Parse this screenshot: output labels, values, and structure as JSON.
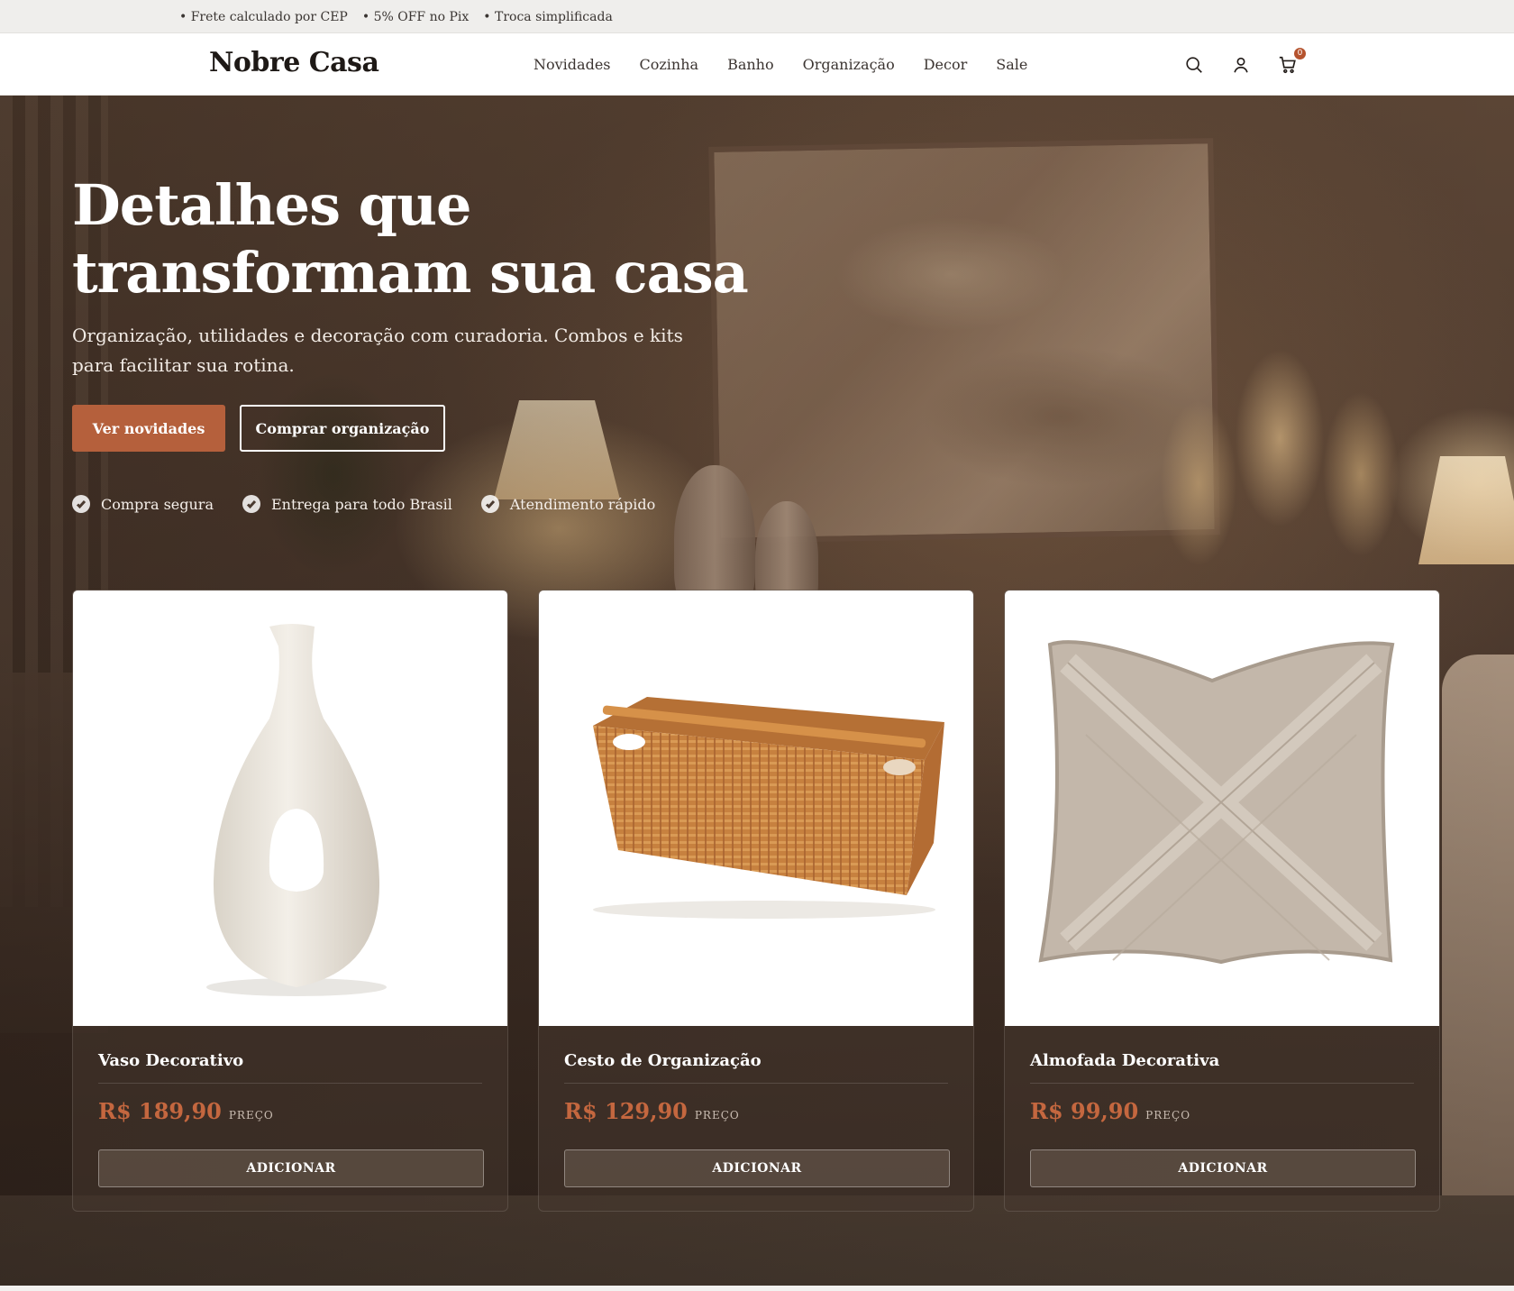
{
  "topbar": {
    "items": [
      "Frete calculado por CEP",
      "5% OFF no Pix",
      "Troca simplificada"
    ]
  },
  "header": {
    "logo": "Nobre Casa",
    "nav": [
      "Novidades",
      "Cozinha",
      "Banho",
      "Organização",
      "Decor",
      "Sale"
    ],
    "icons": [
      "search-icon",
      "user-icon",
      "cart-icon"
    ],
    "cart_count": "0"
  },
  "hero": {
    "title_line1": "Detalhes que",
    "title_line2": "transformam sua casa",
    "subtitle": "Organização, utilidades e decoração com curadoria. Combos e kits para facilitar sua rotina.",
    "primary_cta": "Ver novidades",
    "secondary_cta": "Comprar organização",
    "trust": [
      "Compra segura",
      "Entrega para todo Brasil",
      "Atendimento rápido"
    ]
  },
  "products": [
    {
      "name": "Vaso Decorativo",
      "price": "R$ 189,90",
      "price_label": "PREÇO",
      "button": "ADICIONAR"
    },
    {
      "name": "Cesto de Organização",
      "price": "R$ 129,90",
      "price_label": "PREÇO",
      "button": "ADICIONAR"
    },
    {
      "name": "Almofada Decorativa",
      "price": "R$ 99,90",
      "price_label": "PREÇO",
      "button": "ADICIONAR"
    }
  ],
  "colors": {
    "accent": "#b5603c",
    "price": "#c4673f",
    "header_bg": "#ffffff",
    "topbar_bg": "#efeeec"
  }
}
